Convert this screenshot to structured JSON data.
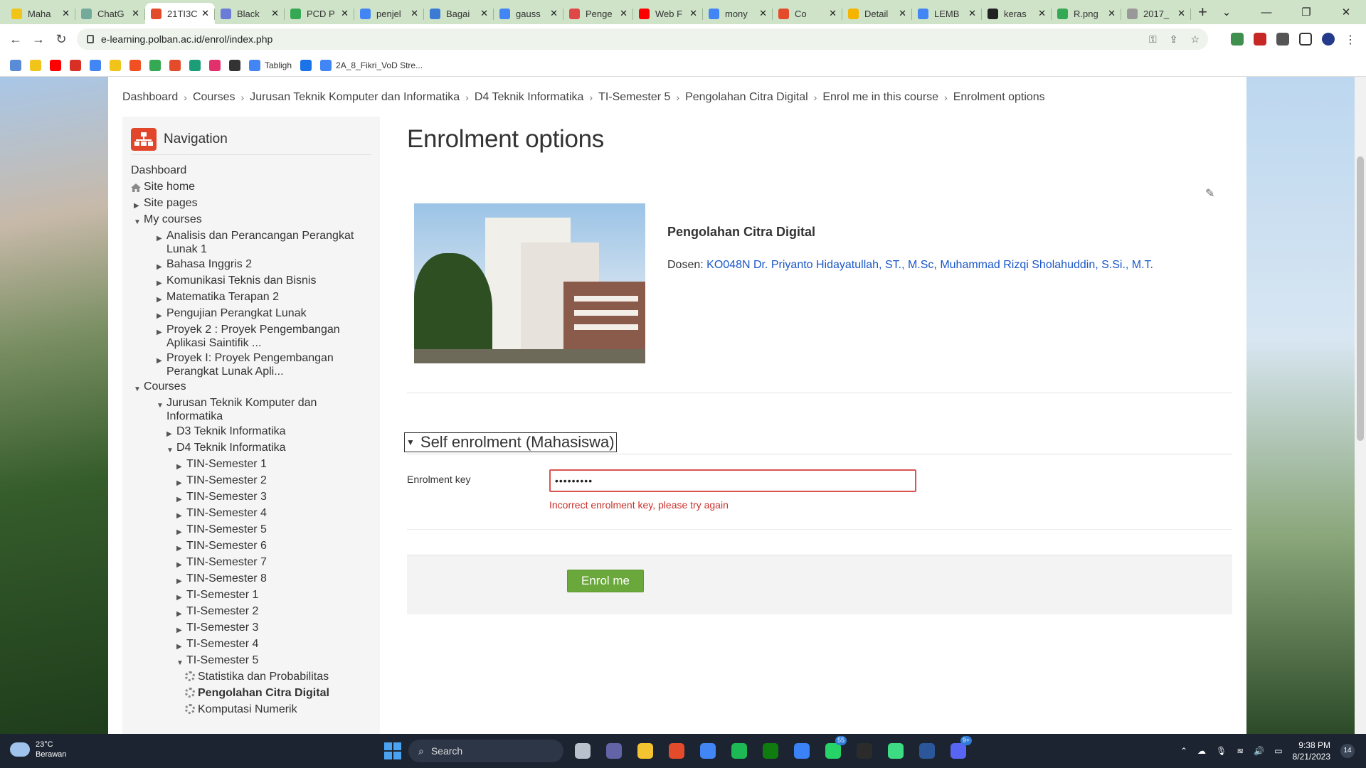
{
  "browser": {
    "tabs": [
      {
        "title": "Maha",
        "color": "#f0c419"
      },
      {
        "title": "ChatG",
        "color": "#74aa9c"
      },
      {
        "title": "21TI3C",
        "color": "#e34b2a"
      },
      {
        "title": "Black",
        "color": "#6b7bd8"
      },
      {
        "title": "PCD P",
        "color": "#34a853"
      },
      {
        "title": "penjel",
        "color": "#4285f4"
      },
      {
        "title": "Bagai",
        "color": "#3b7bd4"
      },
      {
        "title": "gauss",
        "color": "#4285f4"
      },
      {
        "title": "Penge",
        "color": "#e04848"
      },
      {
        "title": "Web F",
        "color": "#ff0000"
      },
      {
        "title": "mony",
        "color": "#4285f4"
      },
      {
        "title": "Co",
        "color": "#e34b2a"
      },
      {
        "title": "Detail",
        "color": "#f4b400"
      },
      {
        "title": "LEMB",
        "color": "#4285f4"
      },
      {
        "title": "keras",
        "color": "#222222"
      },
      {
        "title": "R.png",
        "color": "#34a853"
      },
      {
        "title": "2017_",
        "color": "#999999"
      }
    ],
    "active_tab": 2,
    "url": "e-learning.polban.ac.id/enrol/index.php",
    "bookmarks": [
      {
        "label": "",
        "color": "#5a8bd6"
      },
      {
        "label": "",
        "color": "#f0c419"
      },
      {
        "label": "",
        "color": "#ff0000"
      },
      {
        "label": "",
        "color": "#d93025"
      },
      {
        "label": "",
        "color": "#4285f4"
      },
      {
        "label": "",
        "color": "#f0c419"
      },
      {
        "label": "",
        "color": "#f25022"
      },
      {
        "label": "",
        "color": "#34a853"
      },
      {
        "label": "",
        "color": "#e34b2a"
      },
      {
        "label": "",
        "color": "#1b9e77"
      },
      {
        "label": "",
        "color": "#e1306c"
      },
      {
        "label": "",
        "color": "#333333"
      },
      {
        "label": "Tabligh",
        "color": "#4285f4"
      },
      {
        "label": "",
        "color": "#1a73e8"
      },
      {
        "label": "2A_8_Fikri_VoD Stre...",
        "color": "#4285f4"
      }
    ]
  },
  "breadcrumb": [
    "Dashboard",
    "Courses",
    "Jurusan Teknik Komputer dan Informatika",
    "D4 Teknik Informatika",
    "TI-Semester 5",
    "Pengolahan Citra Digital",
    "Enrol me in this course",
    "Enrolment options"
  ],
  "nav": {
    "title": "Navigation",
    "items": [
      {
        "label": "Dashboard",
        "level": 0,
        "icon": "none"
      },
      {
        "label": "Site home",
        "level": 0,
        "icon": "house"
      },
      {
        "label": "Site pages",
        "level": 0,
        "icon": "right"
      },
      {
        "label": "My courses",
        "level": 0,
        "icon": "down"
      },
      {
        "label": "Analisis dan Perancangan Perangkat Lunak 1",
        "level": 1,
        "icon": "right"
      },
      {
        "label": "Bahasa Inggris 2",
        "level": 1,
        "icon": "right"
      },
      {
        "label": "Komunikasi Teknis dan Bisnis",
        "level": 1,
        "icon": "right"
      },
      {
        "label": "Matematika Terapan 2",
        "level": 1,
        "icon": "right"
      },
      {
        "label": "Pengujian Perangkat Lunak",
        "level": 1,
        "icon": "right"
      },
      {
        "label": "Proyek 2 : Proyek Pengembangan Aplikasi Saintifik ...",
        "level": 1,
        "icon": "right"
      },
      {
        "label": "Proyek I: Proyek Pengembangan Perangkat Lunak Apli...",
        "level": 1,
        "icon": "right"
      },
      {
        "label": "Courses",
        "level": 0,
        "icon": "down"
      },
      {
        "label": "Jurusan Teknik Komputer dan Informatika",
        "level": 1,
        "icon": "down"
      },
      {
        "label": "D3 Teknik Informatika",
        "level": 2,
        "icon": "right"
      },
      {
        "label": "D4 Teknik Informatika",
        "level": 2,
        "icon": "down"
      },
      {
        "label": "TIN-Semester 1",
        "level": 3,
        "icon": "right"
      },
      {
        "label": "TIN-Semester 2",
        "level": 3,
        "icon": "right"
      },
      {
        "label": "TIN-Semester 3",
        "level": 3,
        "icon": "right"
      },
      {
        "label": "TIN-Semester 4",
        "level": 3,
        "icon": "right"
      },
      {
        "label": "TIN-Semester 5",
        "level": 3,
        "icon": "right"
      },
      {
        "label": "TIN-Semester 6",
        "level": 3,
        "icon": "right"
      },
      {
        "label": "TIN-Semester 7",
        "level": 3,
        "icon": "right"
      },
      {
        "label": "TIN-Semester 8",
        "level": 3,
        "icon": "right"
      },
      {
        "label": "TI-Semester 1",
        "level": 3,
        "icon": "right"
      },
      {
        "label": "TI-Semester 2",
        "level": 3,
        "icon": "right"
      },
      {
        "label": "TI-Semester 3",
        "level": 3,
        "icon": "right"
      },
      {
        "label": "TI-Semester 4",
        "level": 3,
        "icon": "right"
      },
      {
        "label": "TI-Semester 5",
        "level": 3,
        "icon": "down"
      },
      {
        "label": "Statistika dan Probabilitas",
        "level": 4,
        "icon": "gear"
      },
      {
        "label": "Pengolahan Citra Digital",
        "level": 4,
        "icon": "gear",
        "bold": true
      },
      {
        "label": "Komputasi Numerik",
        "level": 4,
        "icon": "gear"
      }
    ]
  },
  "main": {
    "title": "Enrolment options",
    "course_name": "Pengolahan Citra Digital",
    "dosen_label": "Dosen:",
    "dosen_1": "KO048N Dr. Priyanto Hidayatullah, ST., M.Sc",
    "dosen_sep": ",",
    "dosen_2": "Muhammad Rizqi Sholahuddin, S.Si., M.T.",
    "fieldset": "Self enrolment (Mahasiswa)",
    "key_label": "Enrolment key",
    "key_value": "•••••••••",
    "key_error": "Incorrect enrolment key, please try again",
    "enrol_button": "Enrol me"
  },
  "taskbar": {
    "temp": "23°C",
    "weather": "Berawan",
    "search": "Search",
    "apps": [
      {
        "color": "#b9c1cc"
      },
      {
        "color": "#6264a7"
      },
      {
        "color": "#f4c430"
      },
      {
        "color": "#e34b2a"
      },
      {
        "color": "#4285f4"
      },
      {
        "color": "#1db954"
      },
      {
        "color": "#107c10"
      },
      {
        "color": "#3b82f6"
      },
      {
        "color": "#25d366",
        "badge": "55"
      },
      {
        "color": "#2b2b2b"
      },
      {
        "color": "#3ddc84"
      },
      {
        "color": "#2b579a"
      },
      {
        "color": "#5865f2",
        "badge": "9+"
      }
    ],
    "time": "9:38 PM",
    "date": "8/21/2023",
    "notifications": "14"
  }
}
